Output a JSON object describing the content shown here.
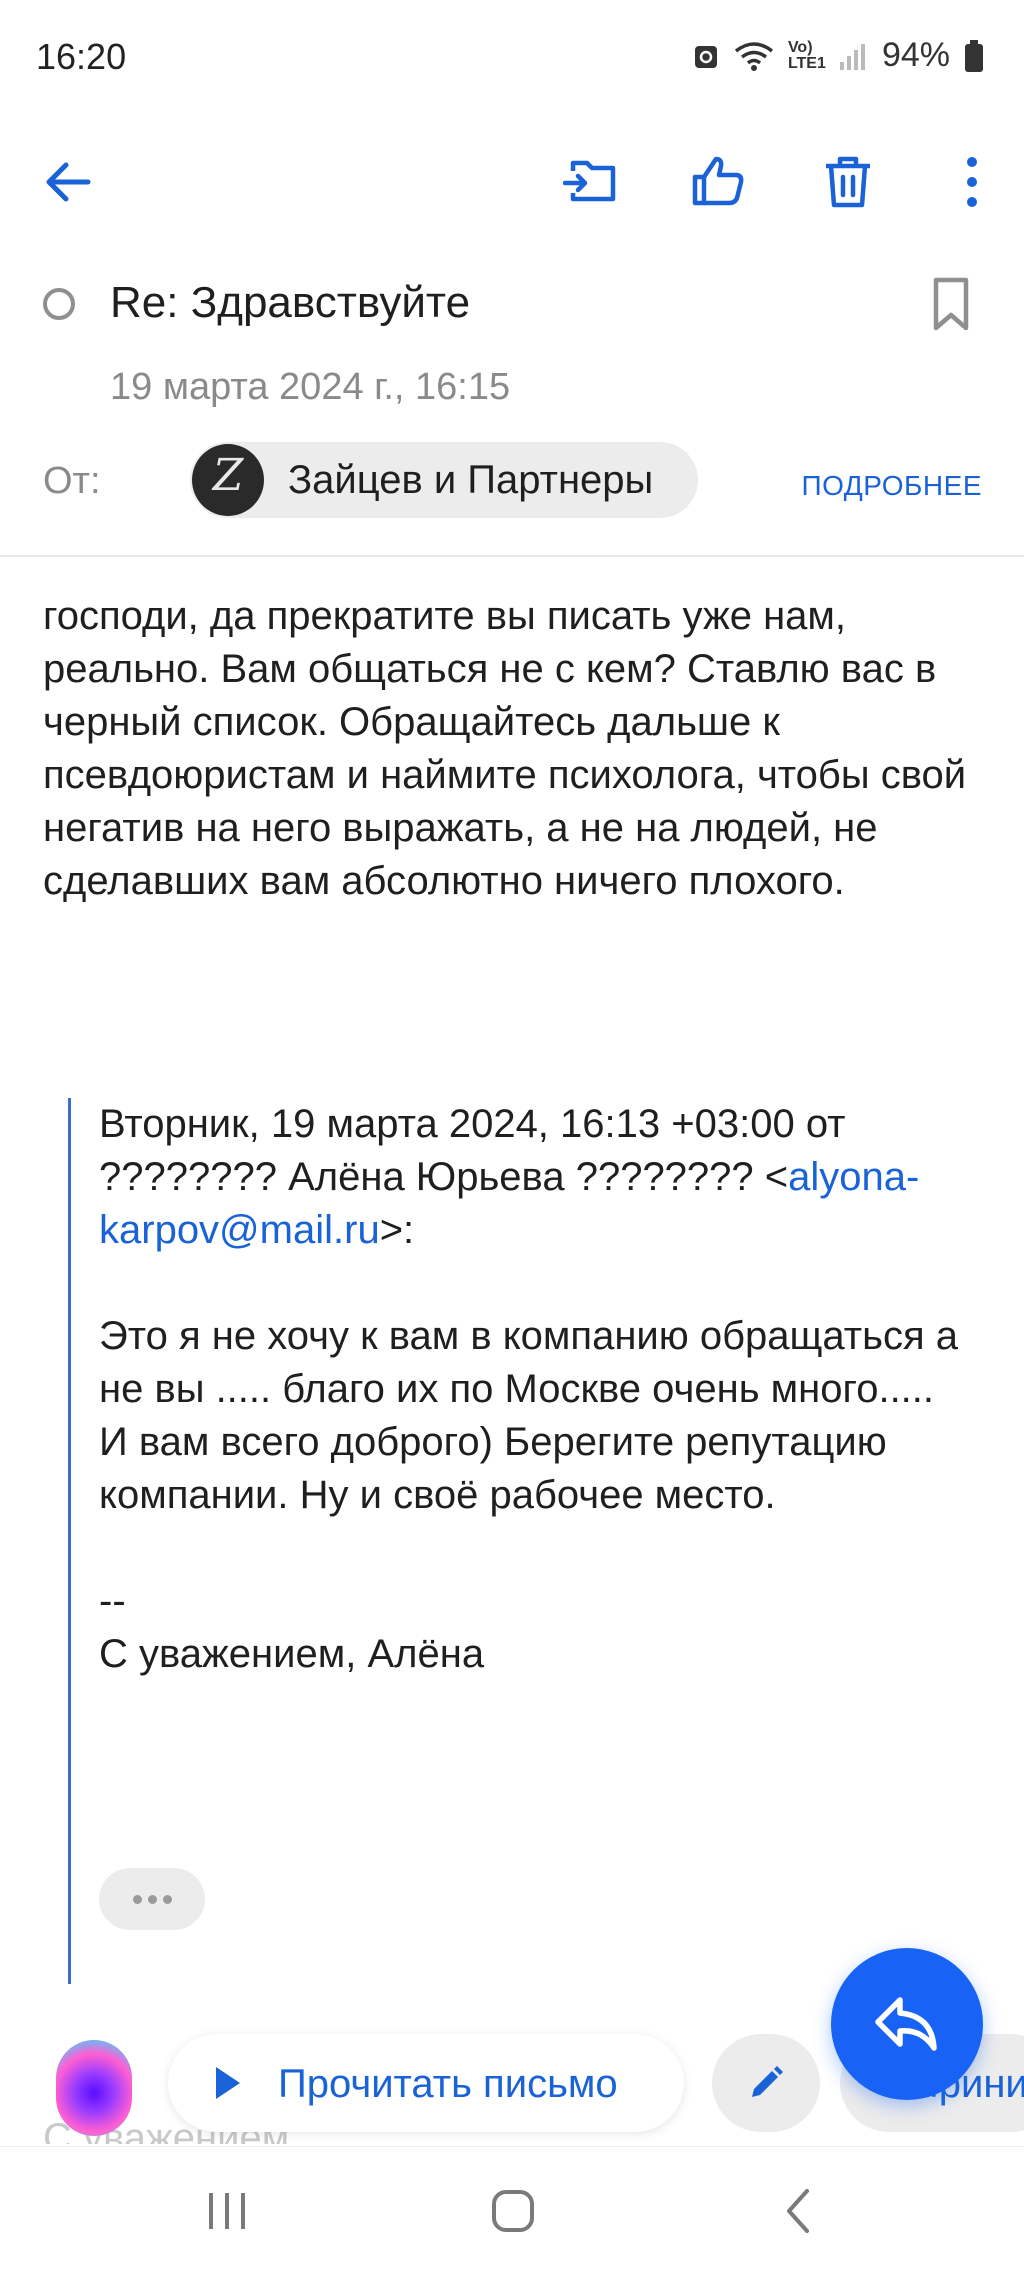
{
  "status_bar": {
    "time": "16:20",
    "network_label": "Vo) LTE1",
    "battery": "94%"
  },
  "message": {
    "subject": "Re: Здравствуйте",
    "date": "19 марта 2024 г., 16:15",
    "from_label": "От:",
    "sender_name": "Зайцев и Партнеры",
    "sender_initial": "Z",
    "details_link": "ПОДРОБНЕЕ",
    "body": "господи, да прекратите вы писать уже нам, реально. Вам общаться не с кем? Ставлю вас в черный список. Обращайтесь дальше к псевдоюристам и наймите психолога, чтобы свой негатив на него выражать, а не на людей, не сделавших вам абсолютно ничего плохого."
  },
  "quote": {
    "header_prefix": "Вторник, 19 марта 2024, 16:13 +03:00 от ???????? Алёна Юрьева ???????? <",
    "email": "alyona-karpov@mail.ru",
    "header_suffix": ">:",
    "text": "Это я не хочу к вам в компанию обращаться а не вы ..... благо их по Москве очень много.....\nИ вам всего доброго)  Берегите репутацию компании. Ну и своё рабочее место.\n\n--\nС уважением, Алёна"
  },
  "actions": {
    "read_label": "Прочитать письмо",
    "accept_label": "Принимаю",
    "peek_text": "С уважением"
  },
  "icons": {
    "back": "arrow-back-icon",
    "move": "move-to-folder-icon",
    "like": "thumbs-up-icon",
    "trash": "trash-icon",
    "more": "more-vertical-icon",
    "bookmark": "bookmark-icon",
    "edit": "pencil-icon",
    "reply": "reply-icon"
  },
  "colors": {
    "accent": "#1a62d8",
    "fab": "#1863f5",
    "muted_text": "#8a8a8a",
    "chip_bg": "#ececec"
  }
}
